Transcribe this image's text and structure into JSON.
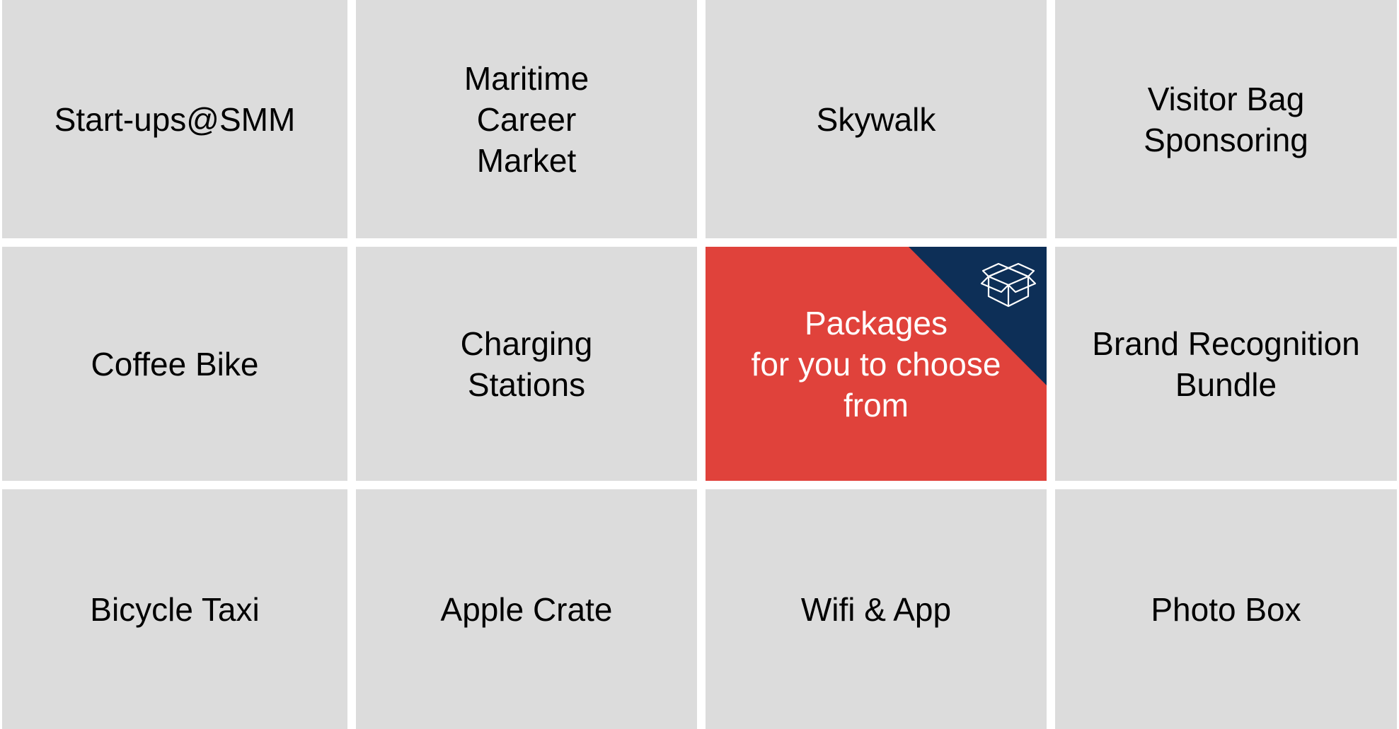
{
  "colors": {
    "tile_background": "#dcdcdc",
    "featured_background": "#e0423b",
    "featured_corner": "#0d2f57",
    "featured_text": "#ffffff",
    "text": "#000000"
  },
  "tiles": [
    {
      "label": "Start-ups@SMM"
    },
    {
      "label": "Maritime\nCareer\nMarket"
    },
    {
      "label": "Skywalk"
    },
    {
      "label": "Visitor Bag\nSponsoring"
    },
    {
      "label": "Coffee Bike"
    },
    {
      "label": "Charging\nStations"
    },
    {
      "label": "Packages\nfor you to choose\nfrom",
      "icon": "package-box-icon"
    },
    {
      "label": "Brand Recognition\nBundle"
    },
    {
      "label": "Bicycle Taxi"
    },
    {
      "label": "Apple Crate"
    },
    {
      "label": "Wifi & App"
    },
    {
      "label": "Photo Box"
    }
  ]
}
